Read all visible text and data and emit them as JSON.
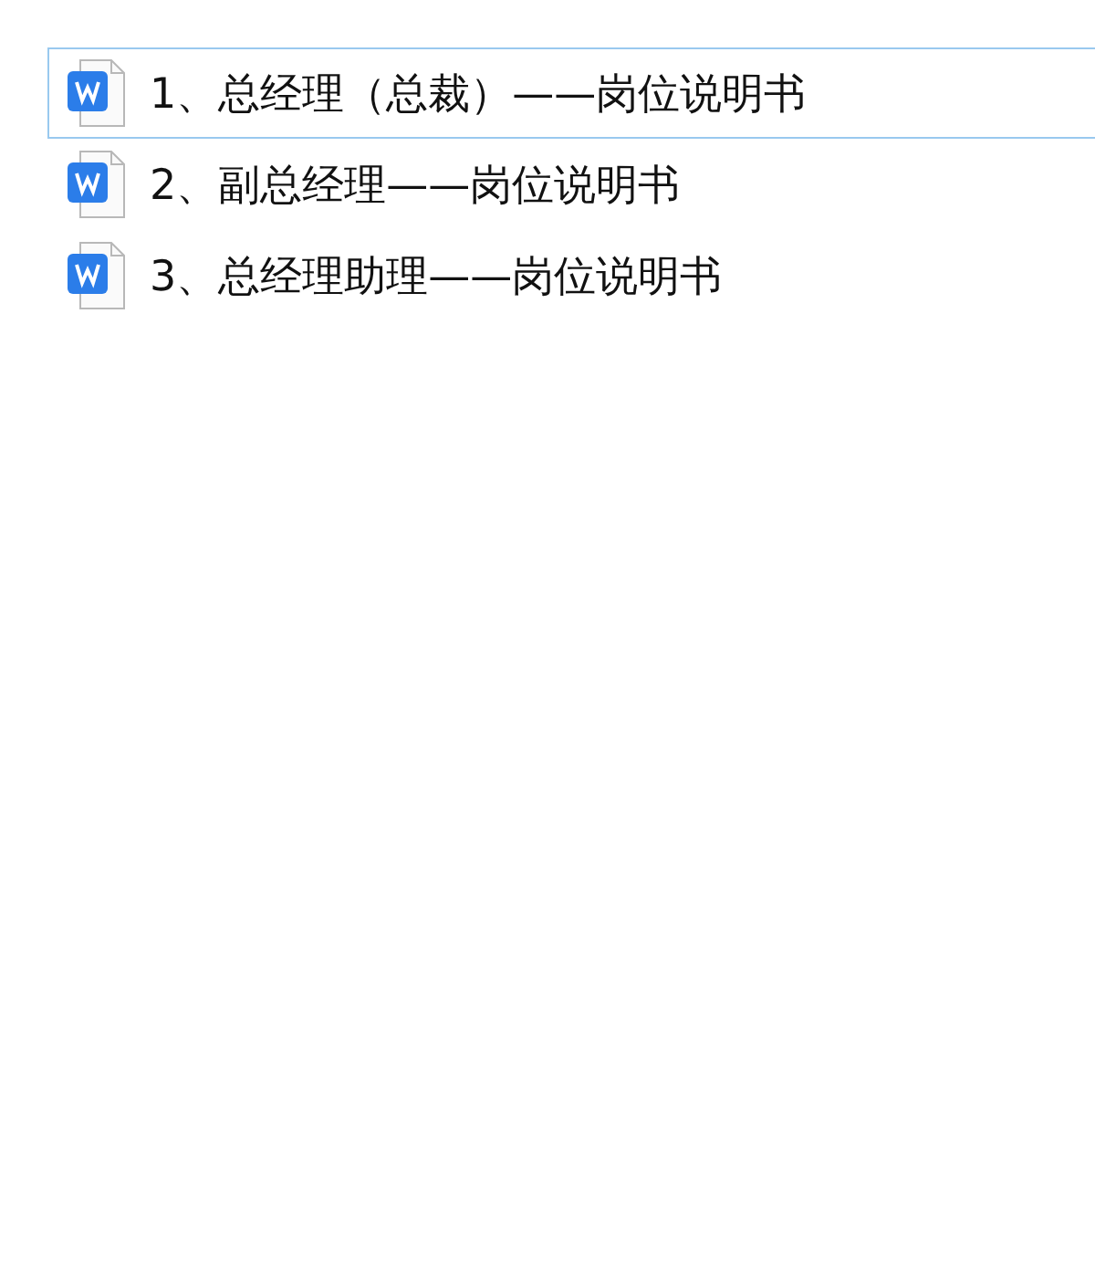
{
  "files": [
    {
      "name": "1、总经理（总裁）——岗位说明书",
      "selected": true
    },
    {
      "name": "2、副总经理——岗位说明书",
      "selected": false
    },
    {
      "name": "3、总经理助理——岗位说明书",
      "selected": false
    }
  ]
}
